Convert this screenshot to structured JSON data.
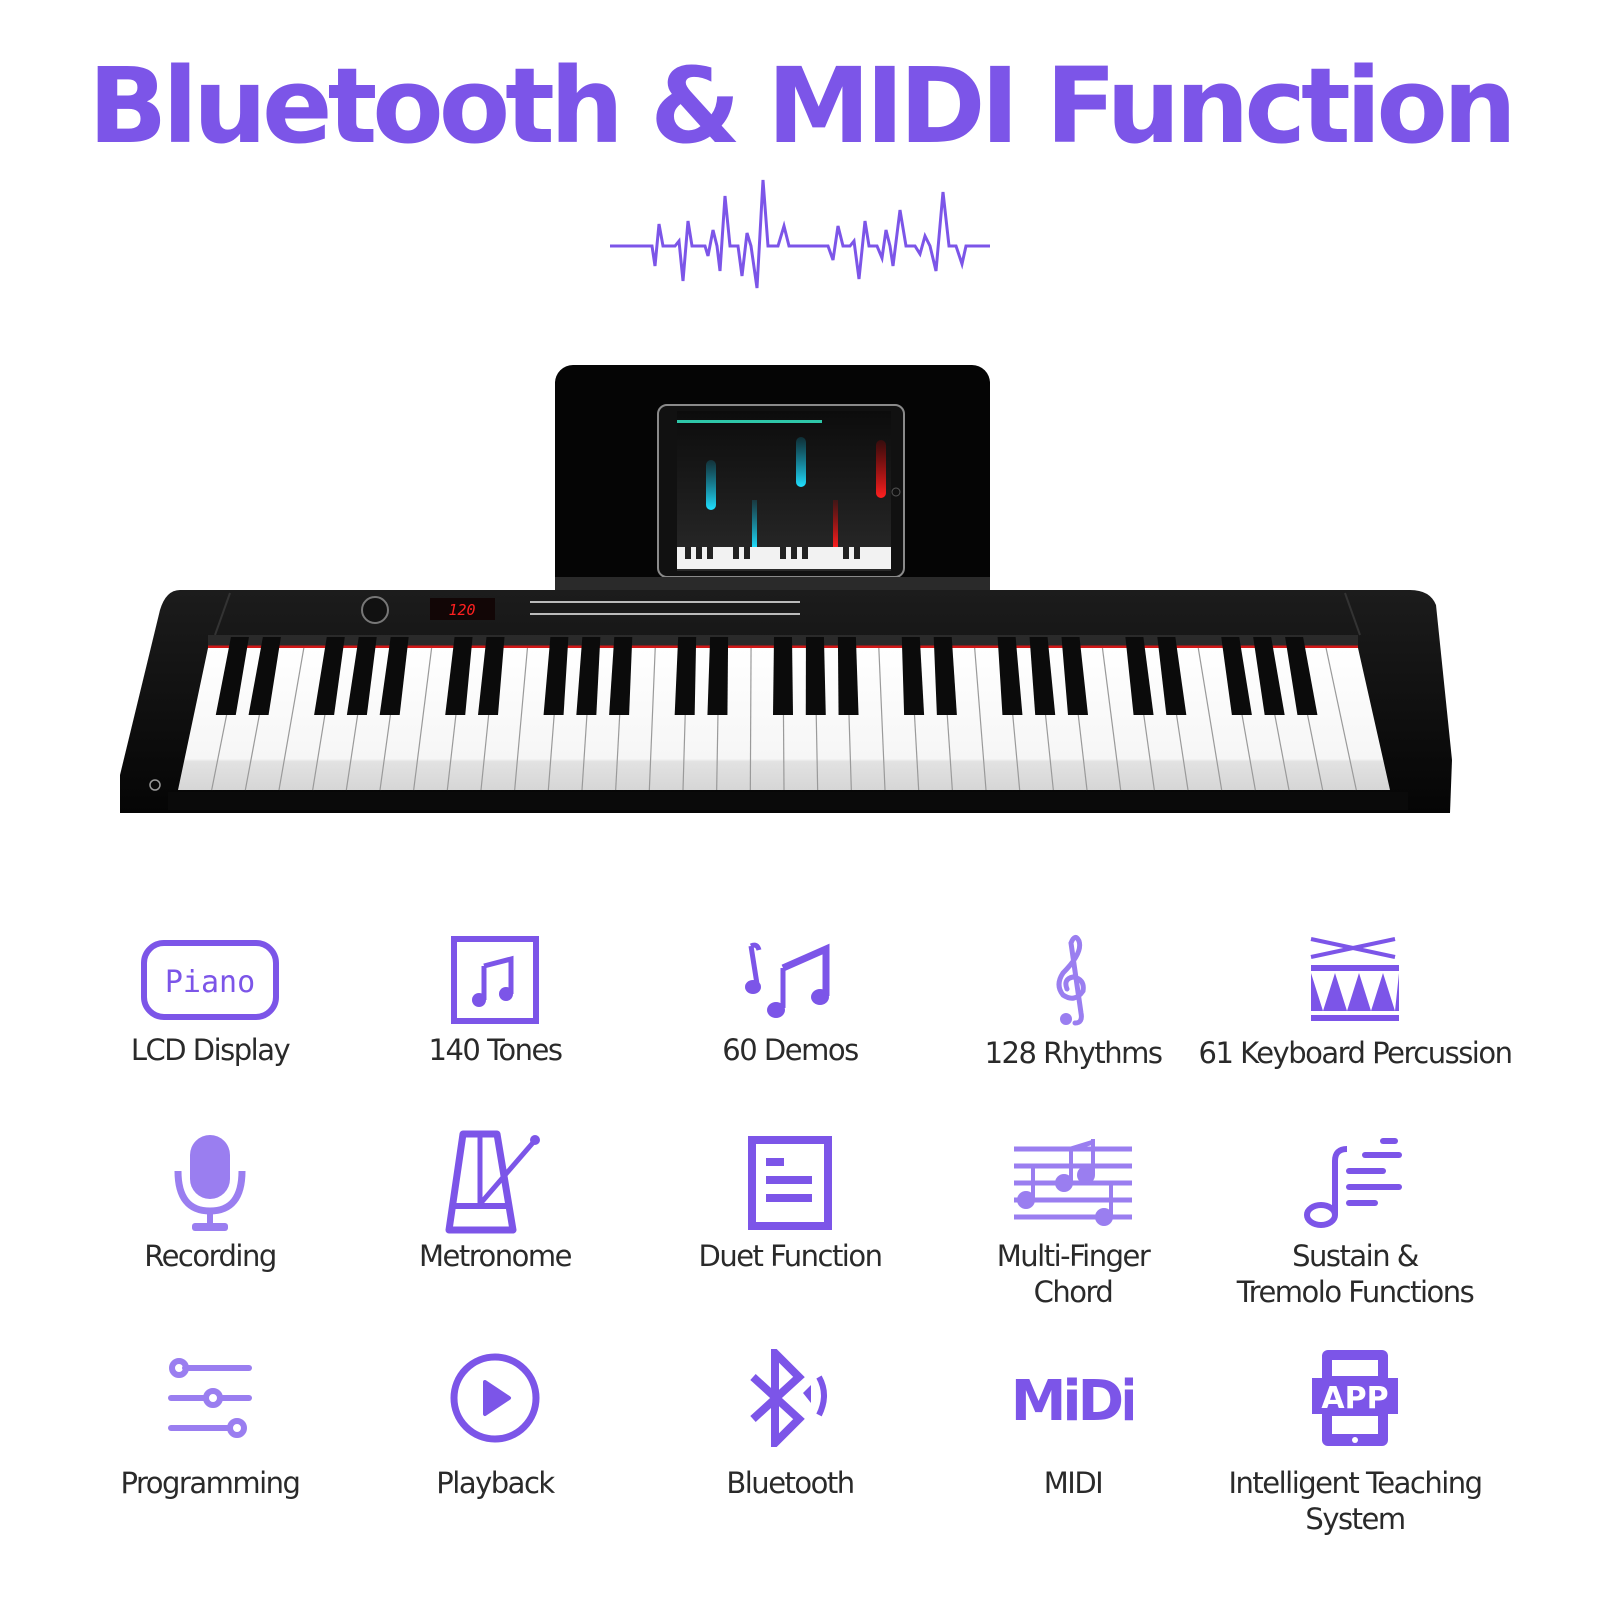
{
  "page": {
    "title": "Bluetooth & MIDI Function",
    "accent_color": "#7c55e8",
    "text_color": "#2a2a2a"
  },
  "product_image": {
    "description": "61-key black electronic keyboard with tablet on music stand",
    "display_readout": "120",
    "tablet_app": "piano teaching app with falling notes"
  },
  "features": [
    {
      "label": "LCD Display",
      "icon": "lcd-piano-display-icon",
      "icon_text": "Piano"
    },
    {
      "label": "140 Tones",
      "icon": "music-note-square-icon"
    },
    {
      "label": "60 Demos",
      "icon": "music-notes-icon"
    },
    {
      "label": "128 Rhythms",
      "icon": "treble-clef-icon"
    },
    {
      "label": "61 Keyboard Percussion",
      "icon": "drum-icon"
    },
    {
      "label": "Recording",
      "icon": "microphone-icon"
    },
    {
      "label": "Metronome",
      "icon": "metronome-icon"
    },
    {
      "label": "Duet Function",
      "icon": "document-icon"
    },
    {
      "label": "Multi-Finger\nChord",
      "icon": "sheet-music-icon"
    },
    {
      "label": "Sustain &\nTremolo Functions",
      "icon": "sustain-note-icon"
    },
    {
      "label": "Programming",
      "icon": "sliders-icon"
    },
    {
      "label": "Playback",
      "icon": "play-circle-icon"
    },
    {
      "label": "Bluetooth",
      "icon": "bluetooth-icon"
    },
    {
      "label": "MIDI",
      "icon": "midi-icon",
      "icon_text": "MiDi"
    },
    {
      "label": "Intelligent Teaching\nSystem",
      "icon": "app-tablet-icon",
      "icon_text": "APP"
    }
  ]
}
